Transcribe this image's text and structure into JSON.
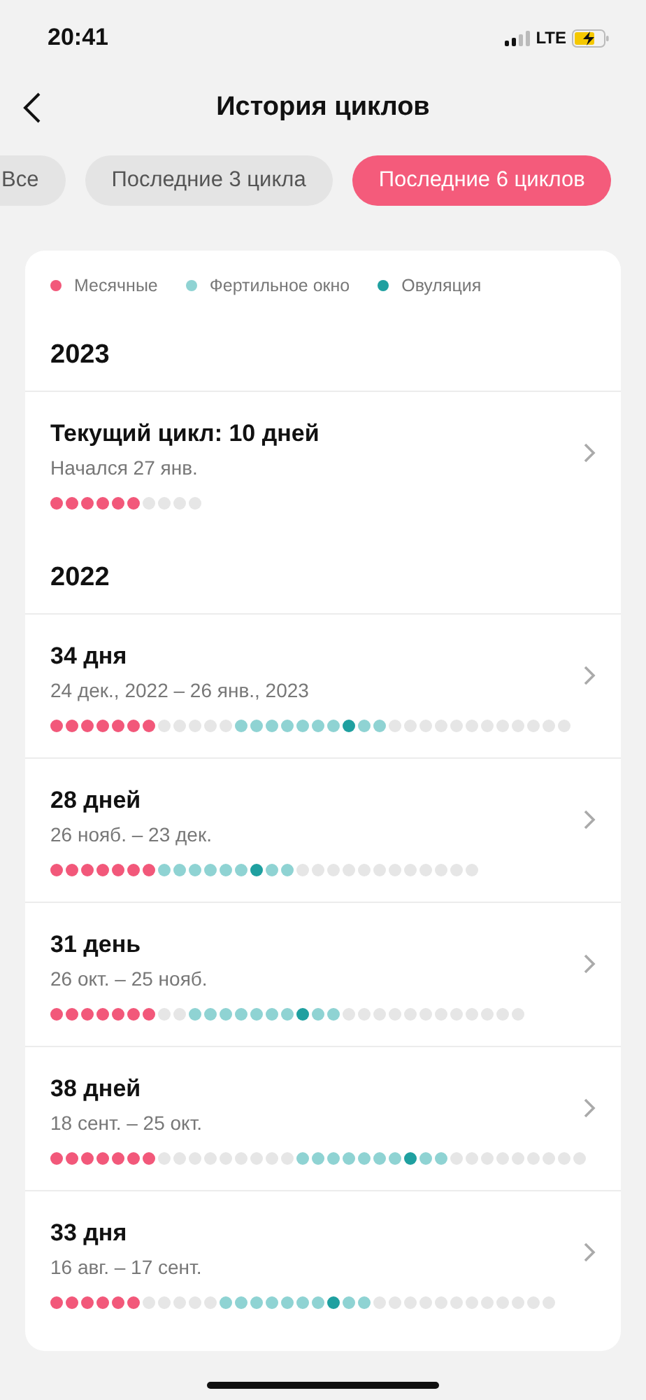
{
  "status_bar": {
    "time": "20:41",
    "network": "LTE"
  },
  "header": {
    "title": "История циклов"
  },
  "filters": [
    {
      "label": "Все",
      "selected": false
    },
    {
      "label": "Последние 3 цикла",
      "selected": false
    },
    {
      "label": "Последние 6 циклов",
      "selected": true
    }
  ],
  "legend": [
    {
      "label": "Месячные",
      "color": "#f2587a"
    },
    {
      "label": "Фертильное окно",
      "color": "#8fd3d3"
    },
    {
      "label": "Овуляция",
      "color": "#1fa0a0"
    }
  ],
  "sections": [
    {
      "year": "2023",
      "cycles": [
        {
          "title": "Текущий цикл: 10 дней",
          "subtitle": "Начался 27 янв.",
          "days": [
            {
              "kind": "period"
            },
            {
              "kind": "period"
            },
            {
              "kind": "period"
            },
            {
              "kind": "period"
            },
            {
              "kind": "period"
            },
            {
              "kind": "period"
            },
            {
              "kind": "none"
            },
            {
              "kind": "none"
            },
            {
              "kind": "none"
            },
            {
              "kind": "none"
            }
          ]
        }
      ]
    },
    {
      "year": "2022",
      "cycles": [
        {
          "title": "34 дня",
          "subtitle": "24 дек., 2022 – 26 янв., 2023",
          "days": [
            {
              "kind": "period"
            },
            {
              "kind": "period"
            },
            {
              "kind": "period"
            },
            {
              "kind": "period"
            },
            {
              "kind": "period"
            },
            {
              "kind": "period"
            },
            {
              "kind": "period"
            },
            {
              "kind": "none"
            },
            {
              "kind": "none"
            },
            {
              "kind": "none"
            },
            {
              "kind": "none"
            },
            {
              "kind": "none"
            },
            {
              "kind": "fertile"
            },
            {
              "kind": "fertile"
            },
            {
              "kind": "fertile"
            },
            {
              "kind": "fertile"
            },
            {
              "kind": "fertile"
            },
            {
              "kind": "fertile"
            },
            {
              "kind": "fertile"
            },
            {
              "kind": "ovulation"
            },
            {
              "kind": "fertile"
            },
            {
              "kind": "fertile"
            },
            {
              "kind": "none"
            },
            {
              "kind": "none"
            },
            {
              "kind": "none"
            },
            {
              "kind": "none"
            },
            {
              "kind": "none"
            },
            {
              "kind": "none"
            },
            {
              "kind": "none"
            },
            {
              "kind": "none"
            },
            {
              "kind": "none"
            },
            {
              "kind": "none"
            },
            {
              "kind": "none"
            },
            {
              "kind": "none"
            }
          ]
        },
        {
          "title": "28 дней",
          "subtitle": "26 нояб. – 23 дек.",
          "days": [
            {
              "kind": "period"
            },
            {
              "kind": "period"
            },
            {
              "kind": "period"
            },
            {
              "kind": "period"
            },
            {
              "kind": "period"
            },
            {
              "kind": "period"
            },
            {
              "kind": "period"
            },
            {
              "kind": "fertile"
            },
            {
              "kind": "fertile"
            },
            {
              "kind": "fertile"
            },
            {
              "kind": "fertile"
            },
            {
              "kind": "fertile"
            },
            {
              "kind": "fertile"
            },
            {
              "kind": "ovulation"
            },
            {
              "kind": "fertile"
            },
            {
              "kind": "fertile"
            },
            {
              "kind": "none"
            },
            {
              "kind": "none"
            },
            {
              "kind": "none"
            },
            {
              "kind": "none"
            },
            {
              "kind": "none"
            },
            {
              "kind": "none"
            },
            {
              "kind": "none"
            },
            {
              "kind": "none"
            },
            {
              "kind": "none"
            },
            {
              "kind": "none"
            },
            {
              "kind": "none"
            },
            {
              "kind": "none"
            }
          ]
        },
        {
          "title": "31 день",
          "subtitle": "26 окт. – 25 нояб.",
          "days": [
            {
              "kind": "period"
            },
            {
              "kind": "period"
            },
            {
              "kind": "period"
            },
            {
              "kind": "period"
            },
            {
              "kind": "period"
            },
            {
              "kind": "period"
            },
            {
              "kind": "period"
            },
            {
              "kind": "none"
            },
            {
              "kind": "none"
            },
            {
              "kind": "fertile"
            },
            {
              "kind": "fertile"
            },
            {
              "kind": "fertile"
            },
            {
              "kind": "fertile"
            },
            {
              "kind": "fertile"
            },
            {
              "kind": "fertile"
            },
            {
              "kind": "fertile"
            },
            {
              "kind": "ovulation"
            },
            {
              "kind": "fertile"
            },
            {
              "kind": "fertile"
            },
            {
              "kind": "none"
            },
            {
              "kind": "none"
            },
            {
              "kind": "none"
            },
            {
              "kind": "none"
            },
            {
              "kind": "none"
            },
            {
              "kind": "none"
            },
            {
              "kind": "none"
            },
            {
              "kind": "none"
            },
            {
              "kind": "none"
            },
            {
              "kind": "none"
            },
            {
              "kind": "none"
            },
            {
              "kind": "none"
            }
          ]
        },
        {
          "title": "38 дней",
          "subtitle": "18 сент. – 25 окт.",
          "days": [
            {
              "kind": "period"
            },
            {
              "kind": "period"
            },
            {
              "kind": "period"
            },
            {
              "kind": "period"
            },
            {
              "kind": "period"
            },
            {
              "kind": "period"
            },
            {
              "kind": "period"
            },
            {
              "kind": "none"
            },
            {
              "kind": "none"
            },
            {
              "kind": "none"
            },
            {
              "kind": "none"
            },
            {
              "kind": "none"
            },
            {
              "kind": "none"
            },
            {
              "kind": "none"
            },
            {
              "kind": "none"
            },
            {
              "kind": "none"
            },
            {
              "kind": "fertile"
            },
            {
              "kind": "fertile"
            },
            {
              "kind": "fertile"
            },
            {
              "kind": "fertile"
            },
            {
              "kind": "fertile"
            },
            {
              "kind": "fertile"
            },
            {
              "kind": "fertile"
            },
            {
              "kind": "ovulation"
            },
            {
              "kind": "fertile"
            },
            {
              "kind": "fertile"
            },
            {
              "kind": "none"
            },
            {
              "kind": "none"
            },
            {
              "kind": "none"
            },
            {
              "kind": "none"
            },
            {
              "kind": "none"
            },
            {
              "kind": "none"
            },
            {
              "kind": "none"
            },
            {
              "kind": "none"
            },
            {
              "kind": "none"
            }
          ]
        },
        {
          "title": "33 дня",
          "subtitle": "16 авг. – 17 сент.",
          "days": [
            {
              "kind": "period"
            },
            {
              "kind": "period"
            },
            {
              "kind": "period"
            },
            {
              "kind": "period"
            },
            {
              "kind": "period"
            },
            {
              "kind": "period"
            },
            {
              "kind": "none"
            },
            {
              "kind": "none"
            },
            {
              "kind": "none"
            },
            {
              "kind": "none"
            },
            {
              "kind": "none"
            },
            {
              "kind": "fertile"
            },
            {
              "kind": "fertile"
            },
            {
              "kind": "fertile"
            },
            {
              "kind": "fertile"
            },
            {
              "kind": "fertile"
            },
            {
              "kind": "fertile"
            },
            {
              "kind": "fertile"
            },
            {
              "kind": "ovulation"
            },
            {
              "kind": "fertile"
            },
            {
              "kind": "fertile"
            },
            {
              "kind": "none"
            },
            {
              "kind": "none"
            },
            {
              "kind": "none"
            },
            {
              "kind": "none"
            },
            {
              "kind": "none"
            },
            {
              "kind": "none"
            },
            {
              "kind": "none"
            },
            {
              "kind": "none"
            },
            {
              "kind": "none"
            },
            {
              "kind": "none"
            },
            {
              "kind": "none"
            },
            {
              "kind": "none"
            }
          ]
        }
      ]
    }
  ]
}
